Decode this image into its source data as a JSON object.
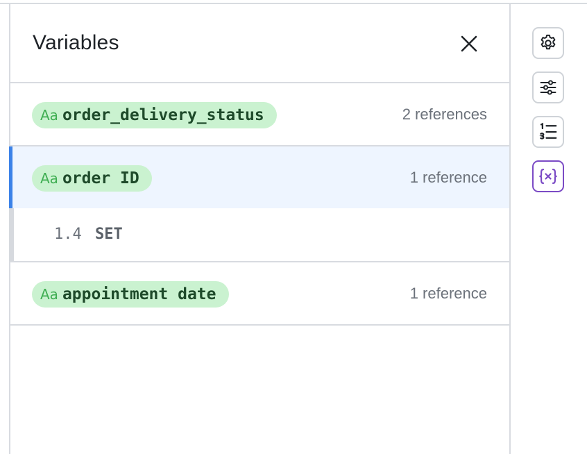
{
  "panel": {
    "title": "Variables"
  },
  "variables": [
    {
      "type_label": "Aa",
      "name": "order_delivery_status",
      "references": "2 references"
    },
    {
      "type_label": "Aa",
      "name": "order ID",
      "references": "1 reference",
      "selected": true,
      "usages": [
        {
          "step": "1.4",
          "action": "SET"
        }
      ]
    },
    {
      "type_label": "Aa",
      "name": "appointment date",
      "references": "1 reference"
    }
  ],
  "toolbar": {
    "buttons": [
      "gear-icon",
      "sliders-icon",
      "numbered-list-icon",
      "variable-icon"
    ],
    "active": "variable-icon"
  },
  "colors": {
    "accent_blue": "#3b82e8",
    "selected_row_bg": "#eef5ff",
    "pill_bg": "#caf2d0",
    "pill_text": "#1e4a2a",
    "type_label": "#3fae52",
    "active_tool": "#7b4bc5"
  }
}
